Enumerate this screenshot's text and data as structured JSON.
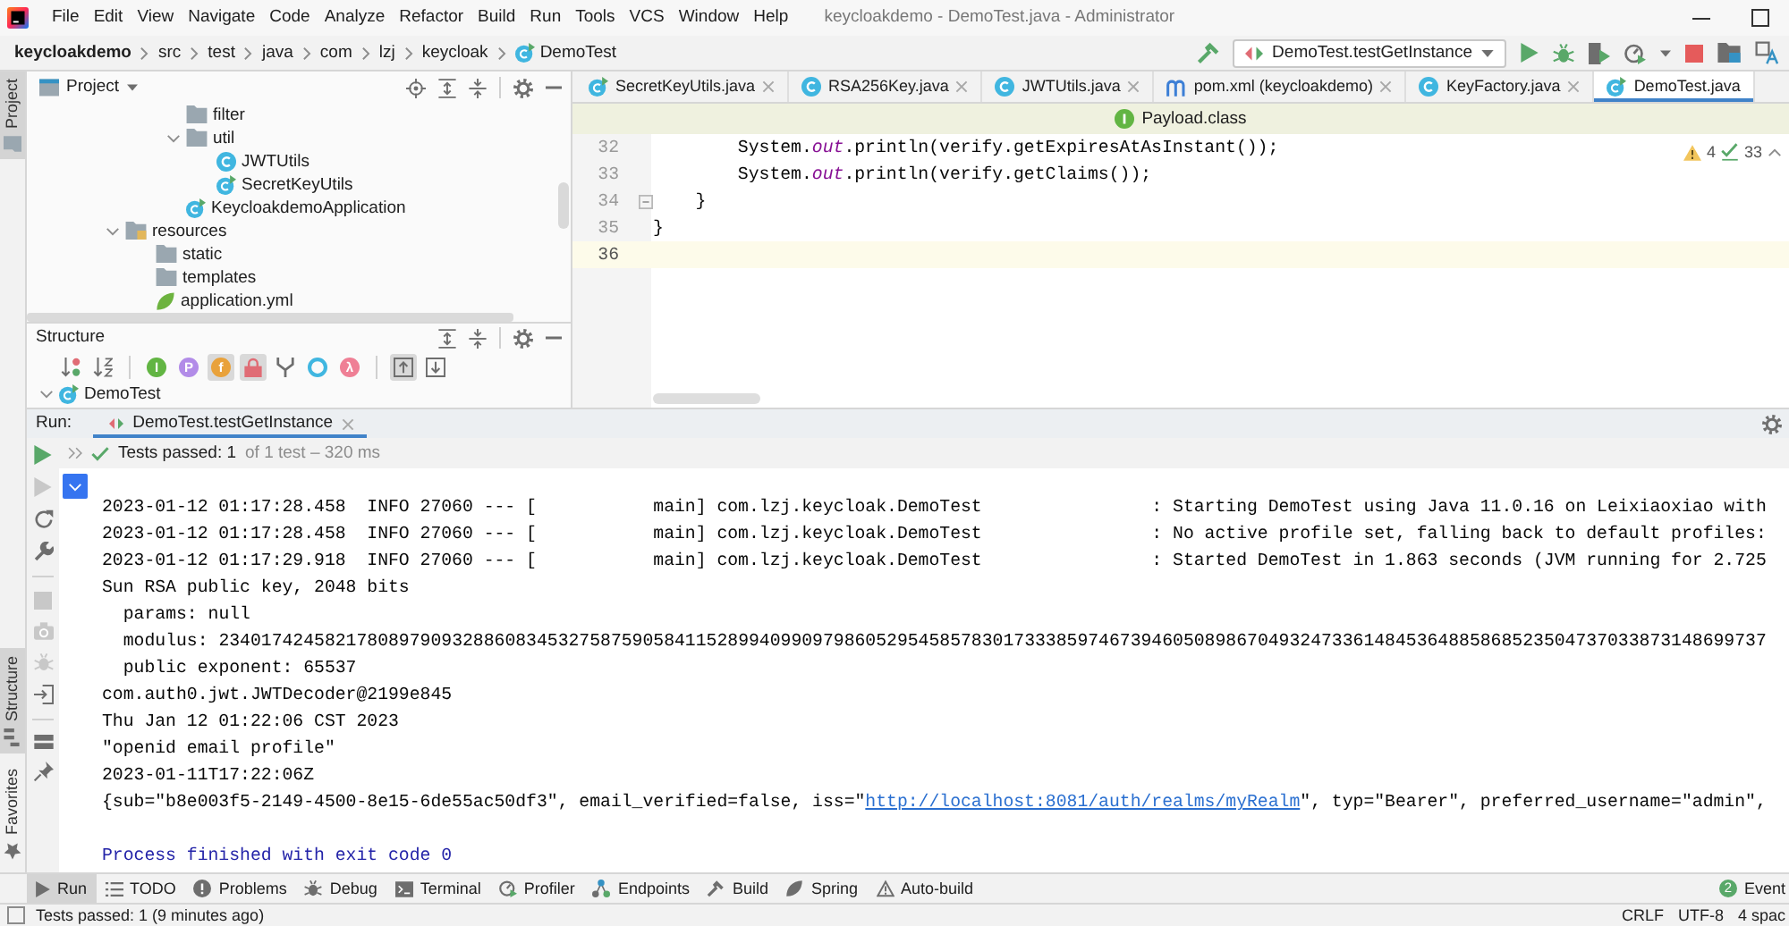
{
  "window": {
    "title": "keycloakdemo - DemoTest.java - Administrator"
  },
  "menu": [
    "File",
    "Edit",
    "View",
    "Navigate",
    "Code",
    "Analyze",
    "Refactor",
    "Build",
    "Run",
    "Tools",
    "VCS",
    "Window",
    "Help"
  ],
  "breadcrumbs": [
    {
      "label": "keycloakdemo",
      "kind": "project"
    },
    {
      "label": "src",
      "kind": "dir"
    },
    {
      "label": "test",
      "kind": "dir"
    },
    {
      "label": "java",
      "kind": "dir"
    },
    {
      "label": "com",
      "kind": "dir"
    },
    {
      "label": "lzj",
      "kind": "dir"
    },
    {
      "label": "keycloak",
      "kind": "dir"
    },
    {
      "label": "DemoTest",
      "kind": "testclass"
    }
  ],
  "run_config": {
    "label": "DemoTest.testGetInstance"
  },
  "side_tabs": [
    {
      "label": "Project",
      "kind": "project",
      "selected": true
    },
    {
      "label": "Structure",
      "kind": "structure",
      "selected": true
    },
    {
      "label": "Favorites",
      "kind": "favorites",
      "selected": false
    }
  ],
  "project_panel": {
    "title": "Project",
    "tree": [
      {
        "children": [
          {
            "children": [
              {
                "label": "filter",
                "kind": "package"
              },
              {
                "label": "util",
                "kind": "package",
                "expanded": true,
                "children": [
                  {
                    "label": "JWTUtils",
                    "kind": "class"
                  },
                  {
                    "label": "SecretKeyUtils",
                    "kind": "mainclass"
                  }
                ]
              },
              {
                "label": "KeycloakdemoApplication",
                "kind": "springclass"
              }
            ]
          }
        ]
      },
      {
        "label": "resources",
        "kind": "resourceroot",
        "expanded": true,
        "children": [
          {
            "label": "static",
            "kind": "folder"
          },
          {
            "label": "templates",
            "kind": "folder"
          },
          {
            "label": "application.yml",
            "kind": "config"
          }
        ]
      }
    ]
  },
  "structure_panel": {
    "title": "Structure",
    "toolbar": [
      [
        {
          "kind": "visibility",
          "on": false
        },
        {
          "kind": "alphabetical",
          "on": false
        }
      ],
      [
        {
          "kind": "interfaces",
          "glyph": "I",
          "on": false
        },
        {
          "kind": "properties",
          "glyph": "P",
          "on": false
        },
        {
          "kind": "fields",
          "glyph": "f",
          "on": true
        },
        {
          "kind": "private",
          "on": true
        },
        {
          "kind": "inherited",
          "on": false
        },
        {
          "kind": "anonymous",
          "on": false
        },
        {
          "kind": "lambdas",
          "glyph": "λ",
          "on": false
        }
      ],
      [
        {
          "kind": "scrollto",
          "on": true
        },
        {
          "kind": "scrollfrom",
          "on": false
        }
      ]
    ],
    "tree": [
      {
        "label": "DemoTest",
        "kind": "testclass",
        "expanded": true
      }
    ]
  },
  "editor": {
    "tabs": [
      {
        "label": "SecretKeyUtils.java",
        "kind": "mainclass",
        "selected": false,
        "closable": true
      },
      {
        "label": "RSA256Key.java",
        "kind": "class",
        "selected": false,
        "closable": true
      },
      {
        "label": "JWTUtils.java",
        "kind": "class",
        "selected": false,
        "closable": true
      },
      {
        "label": "pom.xml (keycloakdemo)",
        "kind": "pom",
        "selected": false,
        "closable": true
      },
      {
        "label": "KeyFactory.java",
        "kind": "libclass",
        "selected": false,
        "closable": true
      },
      {
        "label": "DemoTest.java",
        "kind": "testclass",
        "selected": true,
        "closable": false
      }
    ],
    "banner": {
      "label": "Payload.class"
    },
    "inspections": {
      "warnings": "4",
      "weak_warnings": "33"
    },
    "lines": [
      {
        "number": "32",
        "text": "        System.*out*.println(verify.getExpiresAtAsInstant());",
        "current": false,
        "fold": false
      },
      {
        "number": "33",
        "text": "        System.*out*.println(verify.getClaims());",
        "current": false,
        "fold": false
      },
      {
        "number": "34",
        "text": "    }",
        "current": false,
        "fold": true
      },
      {
        "number": "35",
        "text": "}",
        "current": false,
        "fold": false
      },
      {
        "number": "36",
        "current": true,
        "fold": false
      }
    ]
  },
  "run_panel": {
    "title": "Run:",
    "tabs": [
      {
        "label": "DemoTest.testGetInstance",
        "selected": true
      }
    ],
    "tools": [
      [
        {
          "kind": "rerun",
          "disabled": false
        },
        {
          "kind": "rerunfailed",
          "disabled": true
        },
        {
          "kind": "autotest",
          "disabled": false
        },
        {
          "kind": "settings",
          "disabled": false
        }
      ],
      [
        {
          "kind": "stop",
          "disabled": true
        },
        {
          "kind": "snapshot",
          "disabled": true
        },
        {
          "kind": "debug",
          "disabled": true
        },
        {
          "kind": "import",
          "disabled": false
        }
      ],
      [
        {
          "kind": "layout",
          "disabled": false
        },
        {
          "kind": "pin",
          "disabled": false
        }
      ]
    ],
    "passed": true,
    "summary": "Tests passed: 1",
    "detail": "of 1 test – 320 ms",
    "console_toggle": {
      "on": true
    },
    "console": [
      {
        "kind": "text",
        "text": "2023-01-12 01:17:28.458  INFO 27060 --- [           main] com.lzj.keycloak.DemoTest                : Starting DemoTest using Java 11.0.16 on Leixiaoxiao with"
      },
      {
        "kind": "text",
        "text": "2023-01-12 01:17:28.458  INFO 27060 --- [           main] com.lzj.keycloak.DemoTest                : No active profile set, falling back to default profiles:"
      },
      {
        "kind": "text",
        "text": "2023-01-12 01:17:29.918  INFO 27060 --- [           main] com.lzj.keycloak.DemoTest                : Started DemoTest in 1.863 seconds (JVM running for 2.725"
      },
      {
        "kind": "text",
        "text": "Sun RSA public key, 2048 bits"
      },
      {
        "kind": "text",
        "text": "  params: null"
      },
      {
        "kind": "text",
        "text": "  modulus: 23401742458217808979093288608345327587590584115289940990979860529545857830173338597467394605089867049324733614845364885868523504737033873148699737"
      },
      {
        "kind": "text",
        "text": "  public exponent: 65537"
      },
      {
        "kind": "text",
        "text": "com.auth0.jwt.JWTDecoder@2199e845"
      },
      {
        "kind": "text",
        "text": "Thu Jan 12 01:22:06 CST 2023"
      },
      {
        "kind": "text",
        "text": "\"openid email profile\""
      },
      {
        "kind": "text",
        "text": "2023-01-11T17:22:06Z"
      },
      {
        "kind": "link",
        "before": "{sub=\"b8e003f5-2149-4500-8e15-6de55ac50df3\", email_verified=false, iss=\"",
        "link": "http://localhost:8081/auth/realms/myRealm",
        "after": "\", typ=\"Bearer\", preferred_username=\"admin\","
      },
      {
        "kind": "exit",
        "text": "Process finished with exit code 0"
      }
    ]
  },
  "tool_windows": [
    {
      "label": "Run",
      "kind": "run",
      "selected": true
    },
    {
      "label": "TODO",
      "kind": "todo",
      "selected": false
    },
    {
      "label": "Problems",
      "kind": "problems",
      "selected": false
    },
    {
      "label": "Debug",
      "kind": "debug",
      "selected": false
    },
    {
      "label": "Terminal",
      "kind": "terminal",
      "selected": false
    },
    {
      "label": "Profiler",
      "kind": "profiler",
      "selected": false
    },
    {
      "label": "Endpoints",
      "kind": "endpoints",
      "selected": false
    },
    {
      "label": "Build",
      "kind": "build",
      "selected": false
    },
    {
      "label": "Spring",
      "kind": "spring",
      "selected": false
    },
    {
      "label": "Auto-build",
      "kind": "autobuild",
      "selected": false
    }
  ],
  "event_log": {
    "label": "Event",
    "count": "2"
  },
  "status_bar": {
    "message": "Tests passed: 1 (9 minutes ago)",
    "items": [
      "CRLF",
      "UTF-8",
      "4 spac"
    ]
  }
}
